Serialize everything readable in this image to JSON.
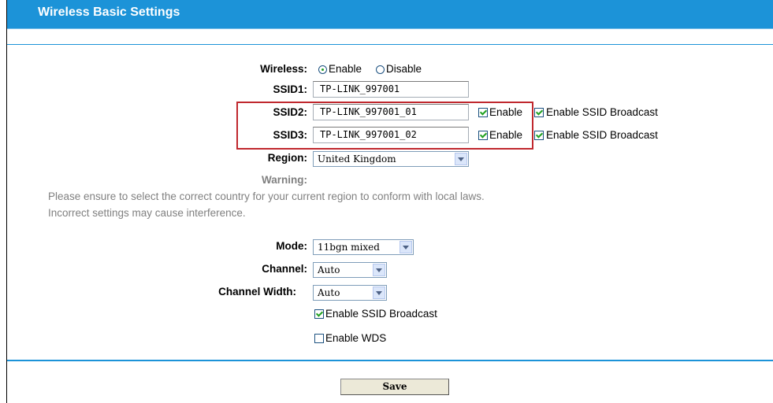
{
  "header": {
    "title": "Wireless Basic Settings"
  },
  "wireless": {
    "label": "Wireless:",
    "enable_label": "Enable",
    "disable_label": "Disable",
    "selected": "Enable"
  },
  "ssid1": {
    "label": "SSID1:",
    "value": "TP-LINK_997001"
  },
  "ssid2": {
    "label": "SSID2:",
    "value": "TP-LINK_997001_01",
    "enable_label": "Enable",
    "enable_checked": true,
    "broadcast_label": "Enable SSID Broadcast",
    "broadcast_checked": true
  },
  "ssid3": {
    "label": "SSID3:",
    "value": "TP-LINK_997001_02",
    "enable_label": "Enable",
    "enable_checked": true,
    "broadcast_label": "Enable SSID Broadcast",
    "broadcast_checked": true
  },
  "region": {
    "label": "Region:",
    "value": "United Kingdom"
  },
  "warning": {
    "label": "Warning:",
    "line1": "Please ensure to select the correct country for your current region to conform with local laws.",
    "line2": "Incorrect settings may cause interference."
  },
  "mode": {
    "label": "Mode:",
    "value": "11bgn mixed"
  },
  "channel": {
    "label": "Channel:",
    "value": "Auto"
  },
  "channel_width": {
    "label": "Channel Width:",
    "value": "Auto"
  },
  "options": {
    "ssid_broadcast_label": "Enable SSID Broadcast",
    "ssid_broadcast_checked": true,
    "wds_label": "Enable WDS",
    "wds_checked": false
  },
  "footer": {
    "save_label": "Save"
  },
  "colors": {
    "accent": "#1c93d8",
    "highlight": "#c0282e"
  }
}
